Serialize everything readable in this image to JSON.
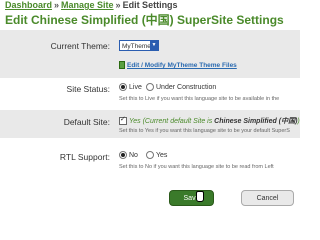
{
  "breadcrumb": {
    "dashboard": "Dashboard",
    "separator": "»",
    "manage_site": "Manage Site",
    "current": "Edit Settings"
  },
  "title": "Edit Chinese Simplified (中国) SuperSite Settings",
  "form": {
    "theme": {
      "label": "Current Theme:",
      "selected": "MyTheme",
      "edit_link": "Edit / Modify MyTheme Theme Files"
    },
    "status": {
      "label": "Site Status:",
      "options": [
        "Live",
        "Under Construction"
      ],
      "selected": "Live",
      "help": "Set this to Live if you want this language site to be available in the"
    },
    "default_site": {
      "label": "Default Site:",
      "checked": true,
      "text_prefix": "Yes (Current default Site is ",
      "text_site": "Chinese Simplified (中国)",
      "text_suffix": ")",
      "help": "Set this to Yes if you want this language site to be your default SuperS"
    },
    "rtl": {
      "label": "RTL Support:",
      "options": [
        "No",
        "Yes"
      ],
      "selected": "No",
      "help": "Set this to No if you want this language site to be read from Left"
    }
  },
  "buttons": {
    "save": "Save",
    "cancel": "Cancel"
  },
  "colors": {
    "accent_green": "#4a8a2a",
    "link_blue": "#2a6ab0",
    "row_shade": "#e9e9e9"
  }
}
